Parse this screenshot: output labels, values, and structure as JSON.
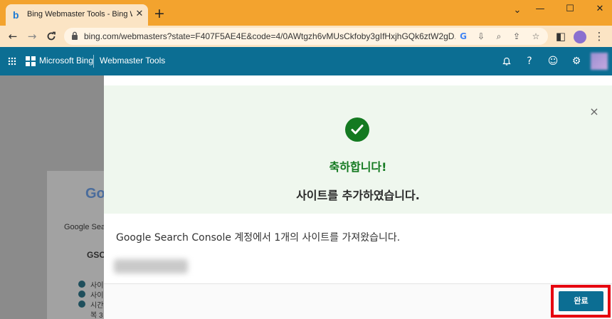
{
  "browser": {
    "tab_title": "Bing Webmaster Tools - Bing W",
    "tab_favicon": "b",
    "tab_close": "✕",
    "new_tab": "+",
    "url": "bing.com/webmasters?state=F407F5AE4E&code=4/0AWtgzh6vMUsCkfoby3gIfHxjhGQk6ztW2gD...",
    "window_controls": {
      "minimize": "—",
      "maximize": "☐",
      "close": "✕"
    },
    "nav": {
      "back": "←",
      "forward": "→",
      "reload": "C"
    }
  },
  "header": {
    "brand": "Microsoft Bing",
    "product": "Webmaster Tools",
    "icons": [
      "bell-icon",
      "help-icon",
      "feedback-smiley-icon",
      "settings-gear-icon",
      "avatar"
    ]
  },
  "background_page": {
    "logo_fragment": "Go",
    "line1": "Google Sea",
    "line2": "GSC",
    "list": [
      "사이",
      "사이",
      "시간",
      "복 3"
    ]
  },
  "modal": {
    "title": "축하합니다!",
    "subtitle": "사이트를 추가하였습니다.",
    "message": "Google Search Console 계정에서 1개의 사이트를 가져왔습니다.",
    "close_icon": "×",
    "done_button": "완료"
  },
  "colors": {
    "bing_header": "#0c6e93",
    "success_green": "#147a21",
    "highlight_red": "#e6000f",
    "browser_frame": "#f3a32e"
  }
}
